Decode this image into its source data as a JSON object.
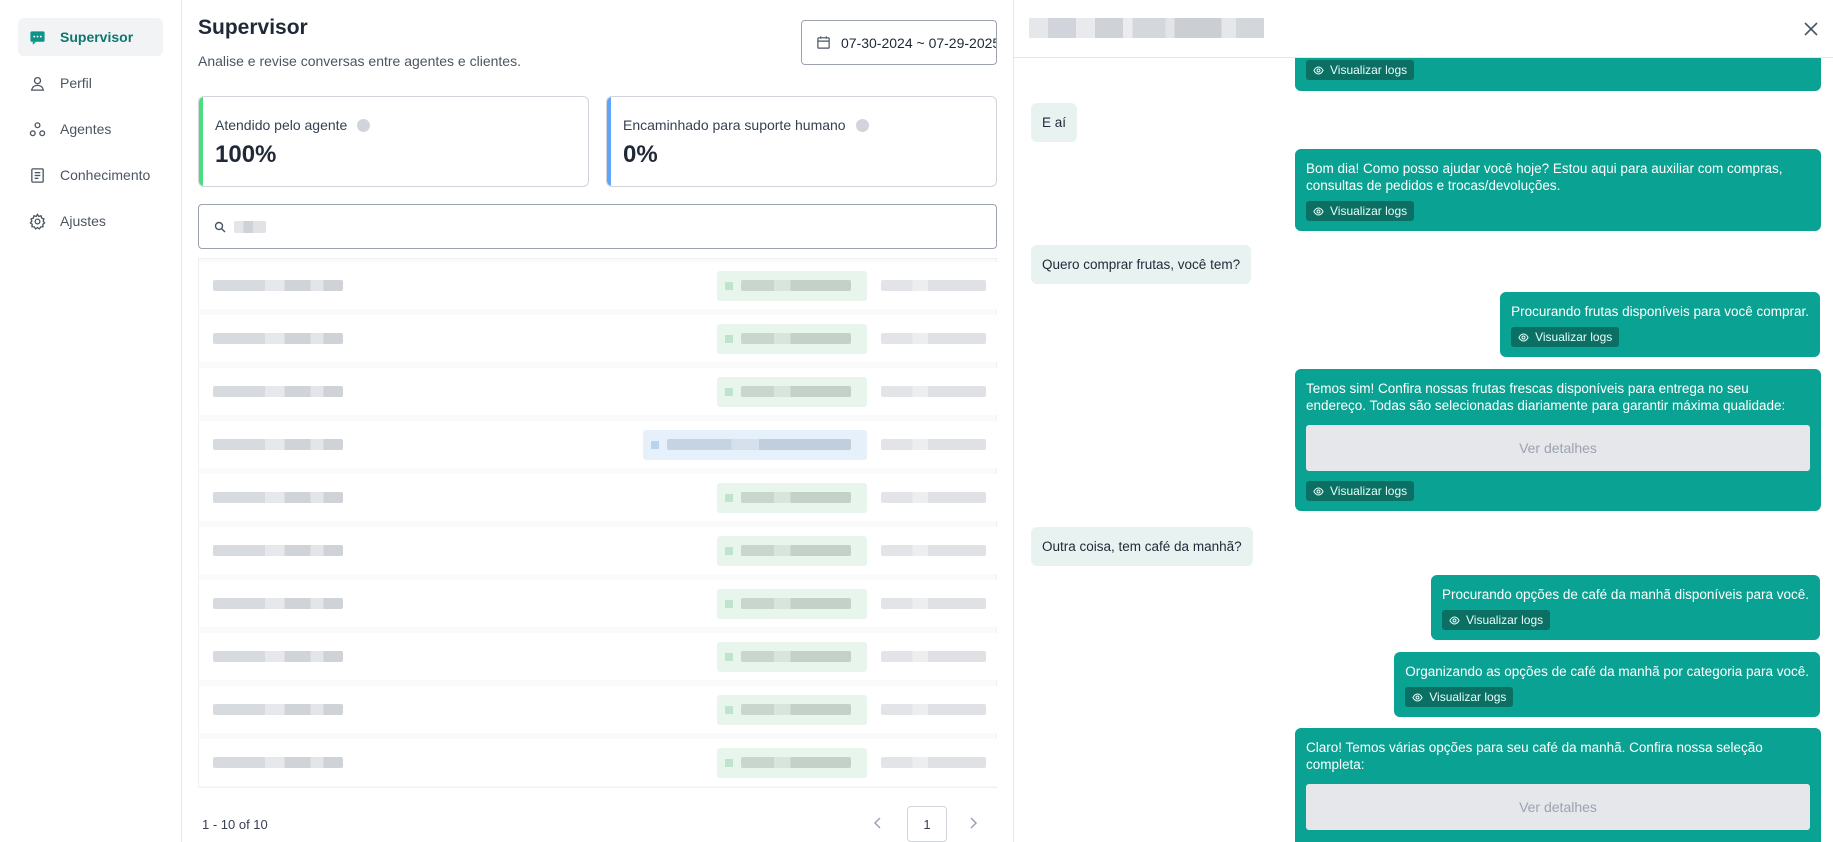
{
  "sidebar": {
    "items": [
      {
        "label": "Supervisor",
        "icon": "chat-icon"
      },
      {
        "label": "Perfil",
        "icon": "user-icon"
      },
      {
        "label": "Agentes",
        "icon": "agents-icon"
      },
      {
        "label": "Conhecimento",
        "icon": "document-icon"
      },
      {
        "label": "Ajustes",
        "icon": "gear-icon"
      }
    ]
  },
  "header": {
    "title": "Supervisor",
    "subtitle": "Analise e revise conversas entre agentes e clientes.",
    "date_range": "07-30-2024 ~ 07-29-2025"
  },
  "stats": [
    {
      "label": "Atendido pelo agente",
      "value": "100%",
      "color": "#4ade80"
    },
    {
      "label": "Encaminhado para suporte humano",
      "value": "0%",
      "color": "#60a5fa"
    }
  ],
  "search": {
    "value": ""
  },
  "pagination": {
    "info": "1 - 10 of 10",
    "current_page": "1"
  },
  "chat": {
    "colors": {
      "bot": "#0aa292",
      "user": "#e8f3f1"
    },
    "logs_label": "Visualizar logs",
    "details_label": "Ver detalhes",
    "messages": [
      {
        "role": "user",
        "text": "E aí"
      },
      {
        "role": "bot",
        "text": "Bom dia! Como posso ajudar você hoje? Estou aqui para auxiliar com compras, consultas de pedidos e trocas/devoluções."
      },
      {
        "role": "user",
        "text": "Quero comprar frutas, você tem?"
      },
      {
        "role": "bot",
        "text": "Procurando frutas disponíveis para você comprar."
      },
      {
        "role": "bot",
        "text": "Temos sim! Confira nossas frutas frescas disponíveis para entrega no seu endereço. Todas são selecionadas diariamente para garantir máxima qualidade:"
      },
      {
        "role": "user",
        "text": "Outra coisa, tem café da manhã?"
      },
      {
        "role": "bot",
        "text": "Procurando opções de café da manhã disponíveis para você."
      },
      {
        "role": "bot",
        "text": "Organizando as opções de café da manhã por categoria para você."
      },
      {
        "role": "bot",
        "text": "Claro! Temos várias opções para seu café da manhã. Confira nossa seleção completa:"
      }
    ]
  }
}
